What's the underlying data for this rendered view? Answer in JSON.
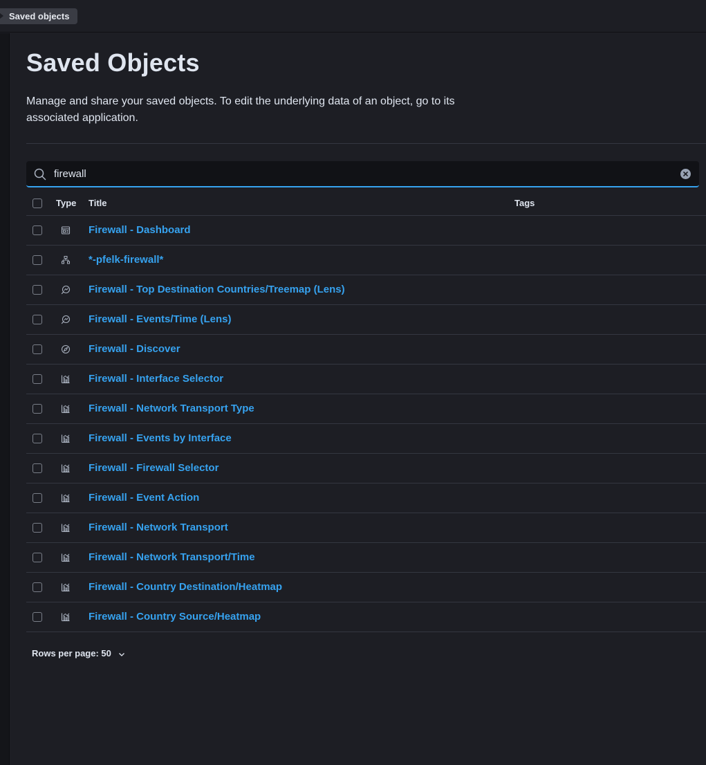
{
  "breadcrumb": {
    "label": "Saved objects"
  },
  "page": {
    "title": "Saved Objects",
    "description": "Manage and share your saved objects. To edit the underlying data of an object, go to its associated application."
  },
  "search": {
    "value": "firewall",
    "icon": "search-icon",
    "clear_icon": "clear-icon"
  },
  "table": {
    "headers": {
      "type": "Type",
      "title": "Title",
      "tags": "Tags"
    },
    "rows": [
      {
        "type": "dashboard",
        "icon": "dashboard-icon",
        "title": "Firewall - Dashboard"
      },
      {
        "type": "index-pattern",
        "icon": "index-pattern-icon",
        "title": "*-pfelk-firewall*"
      },
      {
        "type": "lens",
        "icon": "lens-icon",
        "title": "Firewall - Top Destination Countries/Treemap (Lens)"
      },
      {
        "type": "lens",
        "icon": "lens-icon",
        "title": "Firewall - Events/Time (Lens)"
      },
      {
        "type": "search",
        "icon": "discover-icon",
        "title": "Firewall - Discover"
      },
      {
        "type": "visualization",
        "icon": "visualization-icon",
        "title": "Firewall - Interface Selector"
      },
      {
        "type": "visualization",
        "icon": "visualization-icon",
        "title": "Firewall - Network Transport Type"
      },
      {
        "type": "visualization",
        "icon": "visualization-icon",
        "title": "Firewall - Events by Interface"
      },
      {
        "type": "visualization",
        "icon": "visualization-icon",
        "title": "Firewall - Firewall Selector"
      },
      {
        "type": "visualization",
        "icon": "visualization-icon",
        "title": "Firewall - Event Action"
      },
      {
        "type": "visualization",
        "icon": "visualization-icon",
        "title": "Firewall - Network Transport"
      },
      {
        "type": "visualization",
        "icon": "visualization-icon",
        "title": "Firewall - Network Transport/Time"
      },
      {
        "type": "visualization",
        "icon": "visualization-icon",
        "title": "Firewall - Country Destination/Heatmap"
      },
      {
        "type": "visualization",
        "icon": "visualization-icon",
        "title": "Firewall - Country Source/Heatmap"
      }
    ]
  },
  "pagination": {
    "rows_per_page_label": "Rows per page: 50"
  },
  "colors": {
    "background": "#1d1e24",
    "link": "#36a2ef",
    "border": "#343741",
    "text": "#dfe5ef"
  }
}
